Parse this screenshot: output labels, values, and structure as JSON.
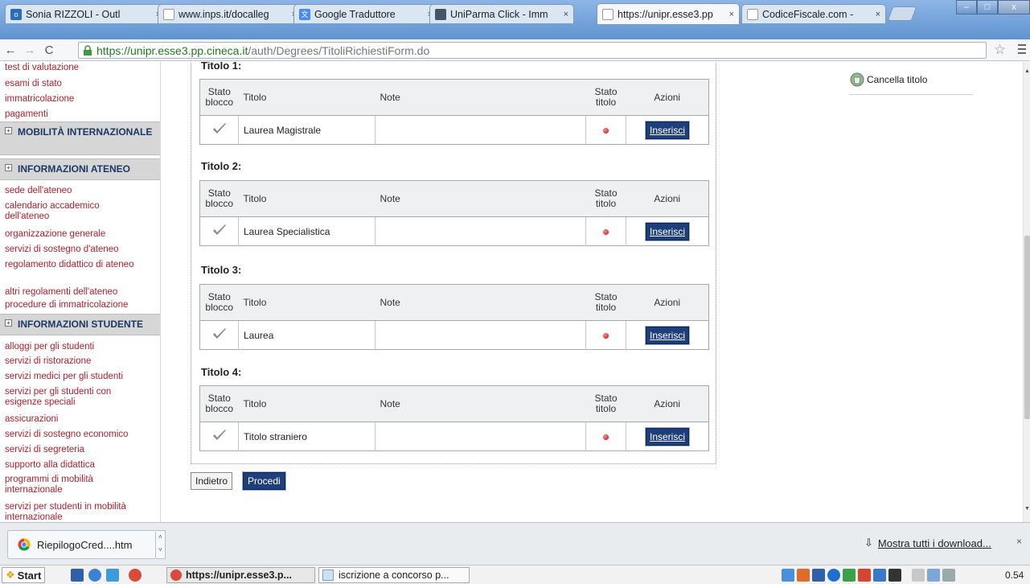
{
  "browser": {
    "tabs": [
      {
        "title": "Sonia RIZZOLI - Outl",
        "icon": "outlook-icon",
        "color": "#2a6ebb"
      },
      {
        "title": "www.inps.it/docalleg",
        "icon": "page-icon",
        "color": "#ffffff"
      },
      {
        "title": "Google Traduttore",
        "icon": "translate-icon",
        "color": "#4a8af4"
      },
      {
        "title": "UniParma Click - Imm",
        "icon": "uniparma-icon",
        "color": "#445566"
      },
      {
        "title": "https://unipr.esse3.pp",
        "icon": "page-icon",
        "color": "#ffffff"
      },
      {
        "title": "CodiceFiscale.com - ",
        "icon": "page-icon",
        "color": "#ffffff"
      }
    ],
    "url_host": "https://unipr.esse3.pp.cineca.it",
    "url_path": "/auth/Degrees/TitoliRichiestiForm.do"
  },
  "sidebar": {
    "links_top": [
      "test di valutazione",
      "esami di stato",
      "immatricolazione",
      "pagamenti"
    ],
    "section_mobilita": "MOBILITÀ INTERNAZIONALE",
    "section_ateneo": "INFORMAZIONI ATENEO",
    "links_ateneo": [
      "sede dell'ateneo",
      "calendario accademico dell'ateneo",
      "organizzazione generale",
      "servizi di sostegno d'ateneo",
      "regolamento didattico di ateneo",
      "altri regolamenti dell'ateneo",
      "procedure di immatricolazione"
    ],
    "section_studente": "INFORMAZIONI STUDENTE",
    "links_studente": [
      "alloggi per gli studenti",
      "servizi di ristorazione",
      "servizi medici per gli studenti",
      "servizi per gli studenti con esigenze speciali",
      "assicurazioni",
      "servizi di sostegno economico",
      "servizi di segreteria",
      "supporto alla didattica",
      "programmi di mobilità internazionale",
      "servizi per studenti in mobilità internazionale"
    ]
  },
  "main": {
    "partial_heading": "Titolo 1:",
    "headers": {
      "stato_blocco": "Stato blocco",
      "titolo": "Titolo",
      "note": "Note",
      "stato_titolo": "Stato titolo",
      "azioni": "Azioni"
    },
    "titoli": [
      {
        "heading": "Titolo 1:",
        "name": "Laurea Magistrale",
        "note": "",
        "action": "Inserisci"
      },
      {
        "heading": "Titolo 2:",
        "name": "Laurea Specialistica",
        "note": "",
        "action": "Inserisci"
      },
      {
        "heading": "Titolo 3:",
        "name": "Laurea",
        "note": "",
        "action": "Inserisci"
      },
      {
        "heading": "Titolo 4:",
        "name": "Titolo straniero",
        "note": "",
        "action": "Inserisci"
      }
    ],
    "btn_back": "Indietro",
    "btn_next": "Procedi",
    "legend_cancella": "Cancella titolo"
  },
  "downloads": {
    "item": "RiepilogoCred....htm",
    "show_all": "Mostra tutti i download..."
  },
  "taskbar": {
    "start": "Start",
    "task1": "https://unipr.esse3.p...",
    "task2": "iscrizione a concorso p...",
    "clock": "0.54"
  },
  "colors": {
    "accent_link": "#b0202c",
    "button_blue": "#1f3f7a",
    "section_text": "#1a3966"
  }
}
